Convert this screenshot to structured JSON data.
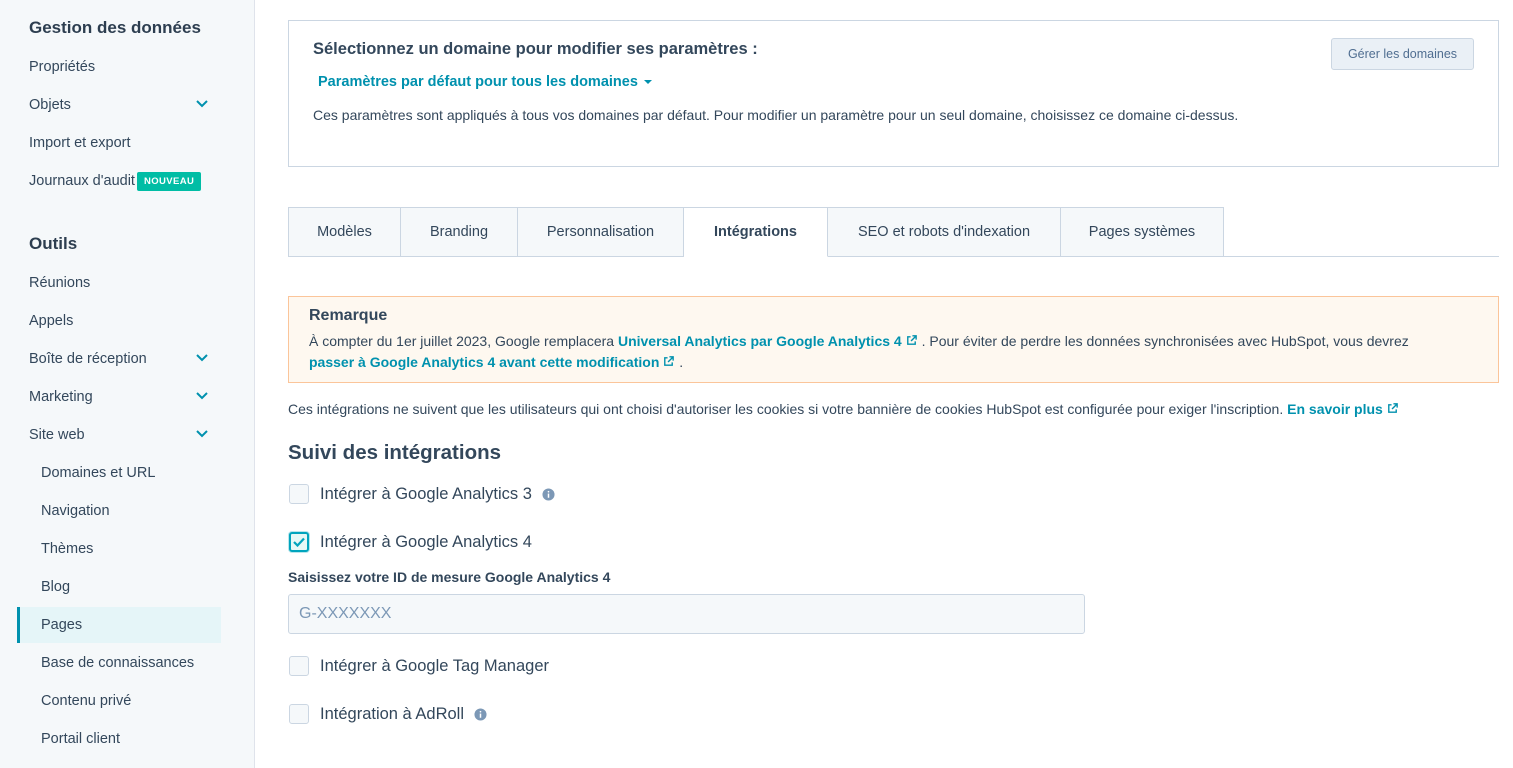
{
  "sidebar": {
    "data_section_title": "Gestion des données",
    "data_items": [
      {
        "label": "Propriétés"
      },
      {
        "label": "Objets"
      },
      {
        "label": "Import et export"
      },
      {
        "label": "Journaux d'audit",
        "badge": "NOUVEAU"
      }
    ],
    "tools_section_title": "Outils",
    "tools_items": [
      {
        "label": "Réunions"
      },
      {
        "label": "Appels"
      },
      {
        "label": "Boîte de réception"
      },
      {
        "label": "Marketing"
      },
      {
        "label": "Site web"
      }
    ],
    "website_subitems": [
      {
        "label": "Domaines et URL"
      },
      {
        "label": "Navigation"
      },
      {
        "label": "Thèmes"
      },
      {
        "label": "Blog"
      },
      {
        "label": "Pages"
      },
      {
        "label": "Base de connaissances"
      },
      {
        "label": "Contenu privé"
      },
      {
        "label": "Portail client"
      }
    ],
    "active_item": "Pages"
  },
  "domain": {
    "title": "Sélectionnez un domaine pour modifier ses paramètres :",
    "selected": "Paramètres par défaut pour tous les domaines",
    "description": "Ces paramètres sont appliqués à tous vos domaines par défaut. Pour modifier un paramètre pour un seul domaine, choisissez ce domaine ci-dessus.",
    "manage_button": "Gérer les domaines"
  },
  "tabs": [
    {
      "label": "Modèles"
    },
    {
      "label": "Branding"
    },
    {
      "label": "Personnalisation"
    },
    {
      "label": "Intégrations"
    },
    {
      "label": "SEO et robots d'indexation"
    },
    {
      "label": "Pages systèmes"
    }
  ],
  "active_tab": "Intégrations",
  "note": {
    "title": "Remarque",
    "text_1": "À compter du 1er juillet 2023, Google remplacera",
    "link_1": "Universal Analytics par Google Analytics 4",
    "text_2": ". Pour éviter de perdre les données synchronisées avec HubSpot, vous devrez",
    "link_2": "passer à Google Analytics 4 avant cette modification",
    "text_3": "."
  },
  "info": {
    "text": "Ces intégrations ne suivent que les utilisateurs qui ont choisi d'autoriser les cookies si votre bannière de cookies HubSpot est configurée pour exiger l'inscription.",
    "link": "En savoir plus"
  },
  "tracking": {
    "title": "Suivi des intégrations",
    "options": [
      {
        "label": "Intégrer à Google Analytics 3",
        "checked": false,
        "has_info": true
      },
      {
        "label": "Intégrer à Google Analytics 4",
        "checked": true,
        "has_info": false
      },
      {
        "label": "Intégrer à Google Tag Manager",
        "checked": false,
        "has_info": false
      },
      {
        "label": "Intégration à AdRoll",
        "checked": false,
        "has_info": true
      }
    ],
    "ga4_field_label": "Saisissez votre ID de mesure Google Analytics 4",
    "ga4_placeholder": "G-XXXXXXX",
    "ga4_value": ""
  },
  "colors": {
    "accent": "#0091ae",
    "text": "#33475b",
    "badge": "#00bda5",
    "note_bg": "#fef8f0",
    "note_border": "#fbc59a"
  }
}
